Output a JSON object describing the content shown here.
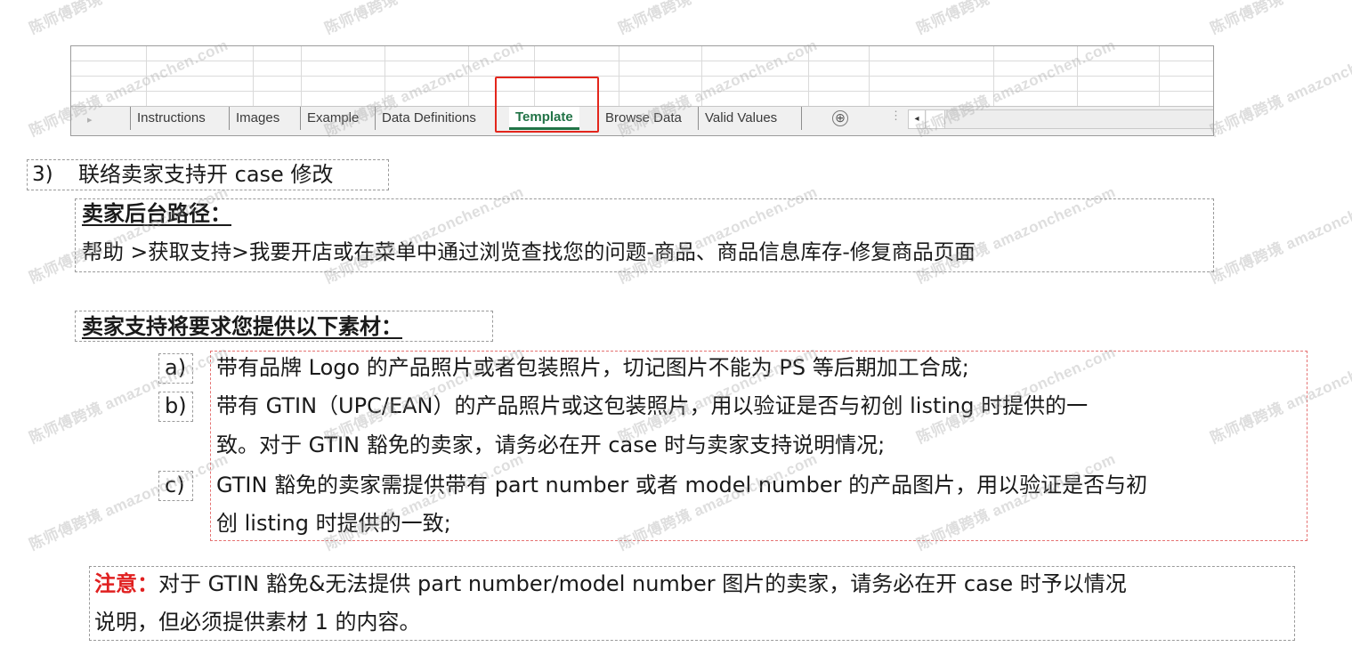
{
  "excel": {
    "nav_arrow": "▸",
    "tabs": [
      {
        "label": "Instructions",
        "active": false
      },
      {
        "label": "Images",
        "active": false
      },
      {
        "label": "Example",
        "active": false
      },
      {
        "label": "Data Definitions",
        "active": false
      },
      {
        "label": "Template",
        "active": true
      },
      {
        "label": "Browse Data",
        "active": false
      },
      {
        "label": "Valid Values",
        "active": false
      }
    ],
    "add_sheet": "⊕",
    "dots": "⋮",
    "scroll_left": "◂",
    "highlight_color": "#e3261c",
    "active_tab_color": "#217346"
  },
  "section": {
    "number": "3)",
    "title": "联络卖家支持开 case 修改"
  },
  "path": {
    "heading": "卖家后台路径：",
    "text": "帮助 >获取支持>我要开店或在菜单中通过浏览查找您的问题-商品、商品信息库存-修复商品页面"
  },
  "materials": {
    "heading": "卖家支持将要求您提供以下素材：",
    "items": [
      {
        "marker": "a)",
        "lines": [
          "带有品牌 Logo 的产品照片或者包装照片，切记图片不能为 PS 等后期加工合成;"
        ]
      },
      {
        "marker": "b)",
        "lines": [
          "带有 GTIN（UPC/EAN）的产品照片或这包装照片，用以验证是否与初创 listing 时提供的一",
          "致。对于 GTIN 豁免的卖家，请务必在开 case 时与卖家支持说明情况;"
        ]
      },
      {
        "marker": "c)",
        "lines": [
          "GTIN 豁免的卖家需提供带有 part number 或者 model number 的产品图片，用以验证是否与初",
          "创 listing 时提供的一致;"
        ]
      }
    ]
  },
  "note": {
    "label": "注意：",
    "line1": "对于 GTIN 豁免&无法提供 part number/model number 图片的卖家，请务必在开 case 时予以情况",
    "line2": "说明，但必须提供素材 1 的内容。",
    "label_color": "#e02020"
  },
  "watermark": {
    "owner": "陈师傅跨境",
    "site": "amazonchen.com"
  }
}
